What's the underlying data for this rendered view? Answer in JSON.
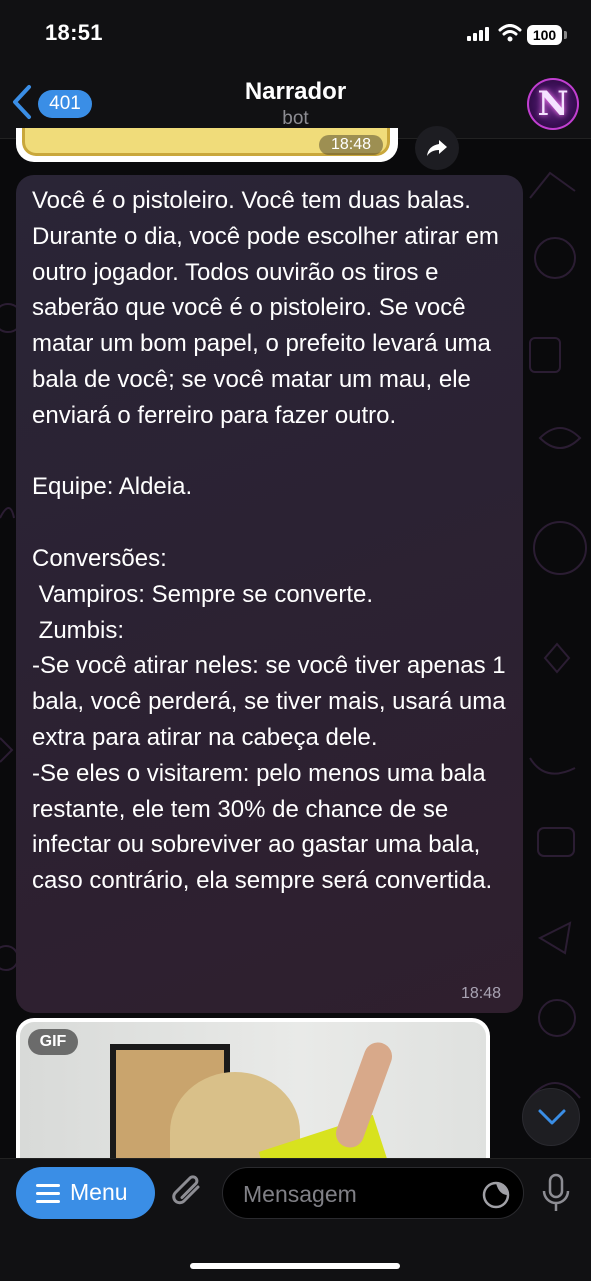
{
  "status_bar": {
    "time": "18:51",
    "battery": "100"
  },
  "header": {
    "back_count": "401",
    "title": "Narrador",
    "subtitle": "bot",
    "avatar_letter": "N"
  },
  "previous_message": {
    "time": "18:48"
  },
  "message": {
    "text": "Você é o pistoleiro. Você tem duas balas. Durante o dia, você pode escolher atirar em outro jogador. Todos ouvirão os tiros e saberão que você é o pistoleiro. Se você matar um bom papel, o prefeito levará uma bala de você; se você matar um mau, ele enviará o ferreiro para fazer outro.\n\nEquipe: Aldeia.\n\nConversões:\n Vampiros: Sempre se converte.\n Zumbis:\n-Se você atirar neles: se você tiver apenas 1 bala, você perderá, se tiver mais, usará uma extra para atirar na cabeça dele.\n-Se eles o visitarem: pelo menos uma bala restante, ele tem 30% de chance de se infectar ou sobreviver ao gastar uma bala, caso contrário, ela sempre será convertida.",
    "time": "18:48"
  },
  "gif_message": {
    "badge": "GIF"
  },
  "input_bar": {
    "menu_label": "Menu",
    "placeholder": "Mensagem"
  },
  "colors": {
    "accent": "#3a8ee6",
    "bubble": "#2b2233",
    "background": "#000000"
  }
}
